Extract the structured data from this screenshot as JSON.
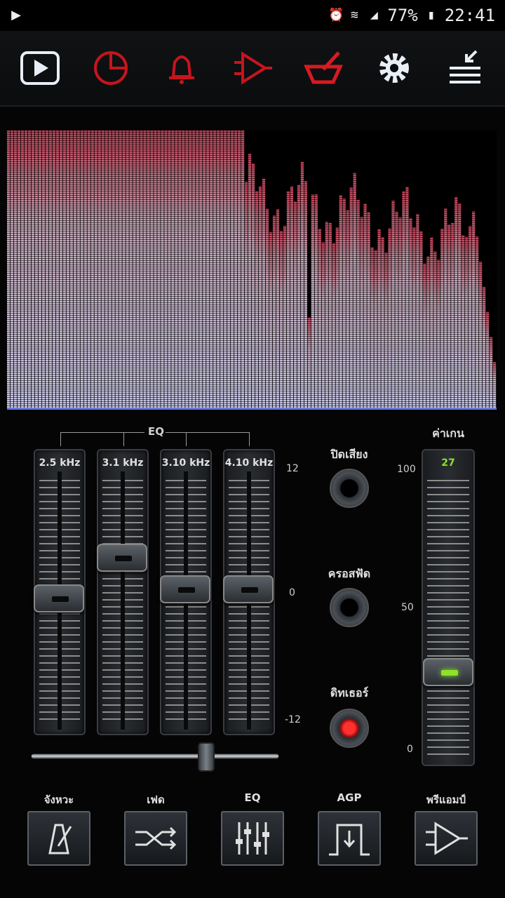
{
  "status_bar": {
    "battery": "77%",
    "time": "22:41"
  },
  "toolbar": {
    "items": [
      "play-icon",
      "timer-icon",
      "bell-icon",
      "amplifier-icon",
      "bowl-icon",
      "gear-icon",
      "menu-icon"
    ]
  },
  "visualizer": {
    "top_color": "#c04055",
    "bottom_color": "#c8c8e6"
  },
  "eq": {
    "label": "EQ",
    "bands": [
      {
        "label": "2.5 kHz",
        "level": 0.5
      },
      {
        "label": "3.1 kHz",
        "level": 0.68
      },
      {
        "label": "3.10 kHz",
        "level": 0.54
      },
      {
        "label": "4.10 kHz",
        "level": 0.54
      }
    ],
    "scale": {
      "top": "12",
      "mid": "0",
      "bottom": "-12"
    },
    "balance": 0.72
  },
  "right_controls": {
    "mute_label": "ปิดเสียง",
    "crossfade_label": "ครอสฟัด",
    "dither_label": "ดิทเธอร์"
  },
  "gain": {
    "label": "ค่าเกน",
    "value": "27",
    "scale": {
      "top": "100",
      "mid": "50",
      "bottom": "0"
    }
  },
  "bottom_buttons": [
    {
      "label": "จังหวะ",
      "icon": "metronome-icon"
    },
    {
      "label": "เฟด",
      "icon": "shuffle-icon"
    },
    {
      "label": "EQ",
      "icon": "sliders-icon"
    },
    {
      "label": "AGP",
      "icon": "agp-icon"
    },
    {
      "label": "พรีแอมป์",
      "icon": "preamp-icon"
    }
  ]
}
